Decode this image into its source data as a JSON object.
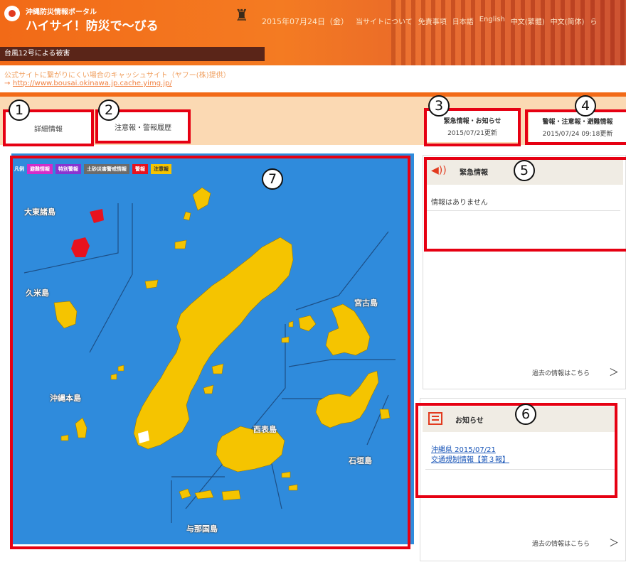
{
  "header": {
    "logo_small": "沖縄防災情報ポータル",
    "logo_big": "ハイサイ！防災で〜びる",
    "date": "2015年07月24日（金）",
    "nav": [
      "当サイトについて",
      "免責事項",
      "日本語",
      "English",
      "中文(繁體)",
      "中文(简体)",
      "ら"
    ],
    "typhoon_bar": "台風12号による被害",
    "cache_note": "公式サイトに繋がりにくい場合のキャッシュサイト（ヤフー(株)提供）",
    "cache_arrow": "→",
    "cache_link": "http://www.bousai.okinawa.jp.cache.yimg.jp/"
  },
  "tabs": {
    "detail": "詳細情報",
    "warnings": "注意報・警報履歴"
  },
  "info_boxes": {
    "emergency_title": "緊急情報・お知らせ",
    "emergency_date": "2015/07/21更新",
    "warnings_title": "警報・注意報・避難情報",
    "warnings_date": "2015/07/24 09:18更新"
  },
  "legend": {
    "label": "凡例",
    "items": [
      {
        "label": "避難情報",
        "color": "#d42cc8"
      },
      {
        "label": "特別警報",
        "color": "#8a34d0"
      },
      {
        "label": "土砂災害警戒情報",
        "color": "#6b6b6b"
      },
      {
        "label": "警報",
        "color": "#e8121e"
      },
      {
        "label": "注意報",
        "color": "#f5c400"
      }
    ]
  },
  "map_labels": {
    "daito": "大東諸島",
    "kume": "久米島",
    "miyako": "宮古島",
    "okinawa": "沖縄本島",
    "iriomote": "西表島",
    "ishigaki": "石垣島",
    "yonaguni": "与那国島"
  },
  "emergency_panel": {
    "title": "緊急情報",
    "message": "情報はありません",
    "more": "過去の情報はこちら",
    "chevron": "＞"
  },
  "notice_panel": {
    "title": "お知らせ",
    "link_line1": "沖縄県 2015/07/21",
    "link_line2": "交通規制情報【第３報】",
    "more": "過去の情報はこちら",
    "chevron": "＞"
  },
  "annotations": [
    "1",
    "2",
    "3",
    "4",
    "5",
    "6",
    "7"
  ],
  "colors": {
    "header_orange": "#f26a17",
    "band": "#fbd9b3",
    "highlight_red": "#e60012",
    "sea_blue": "#2f8bdc",
    "advisory_yellow": "#f5c400",
    "warning_red": "#e8121e"
  }
}
